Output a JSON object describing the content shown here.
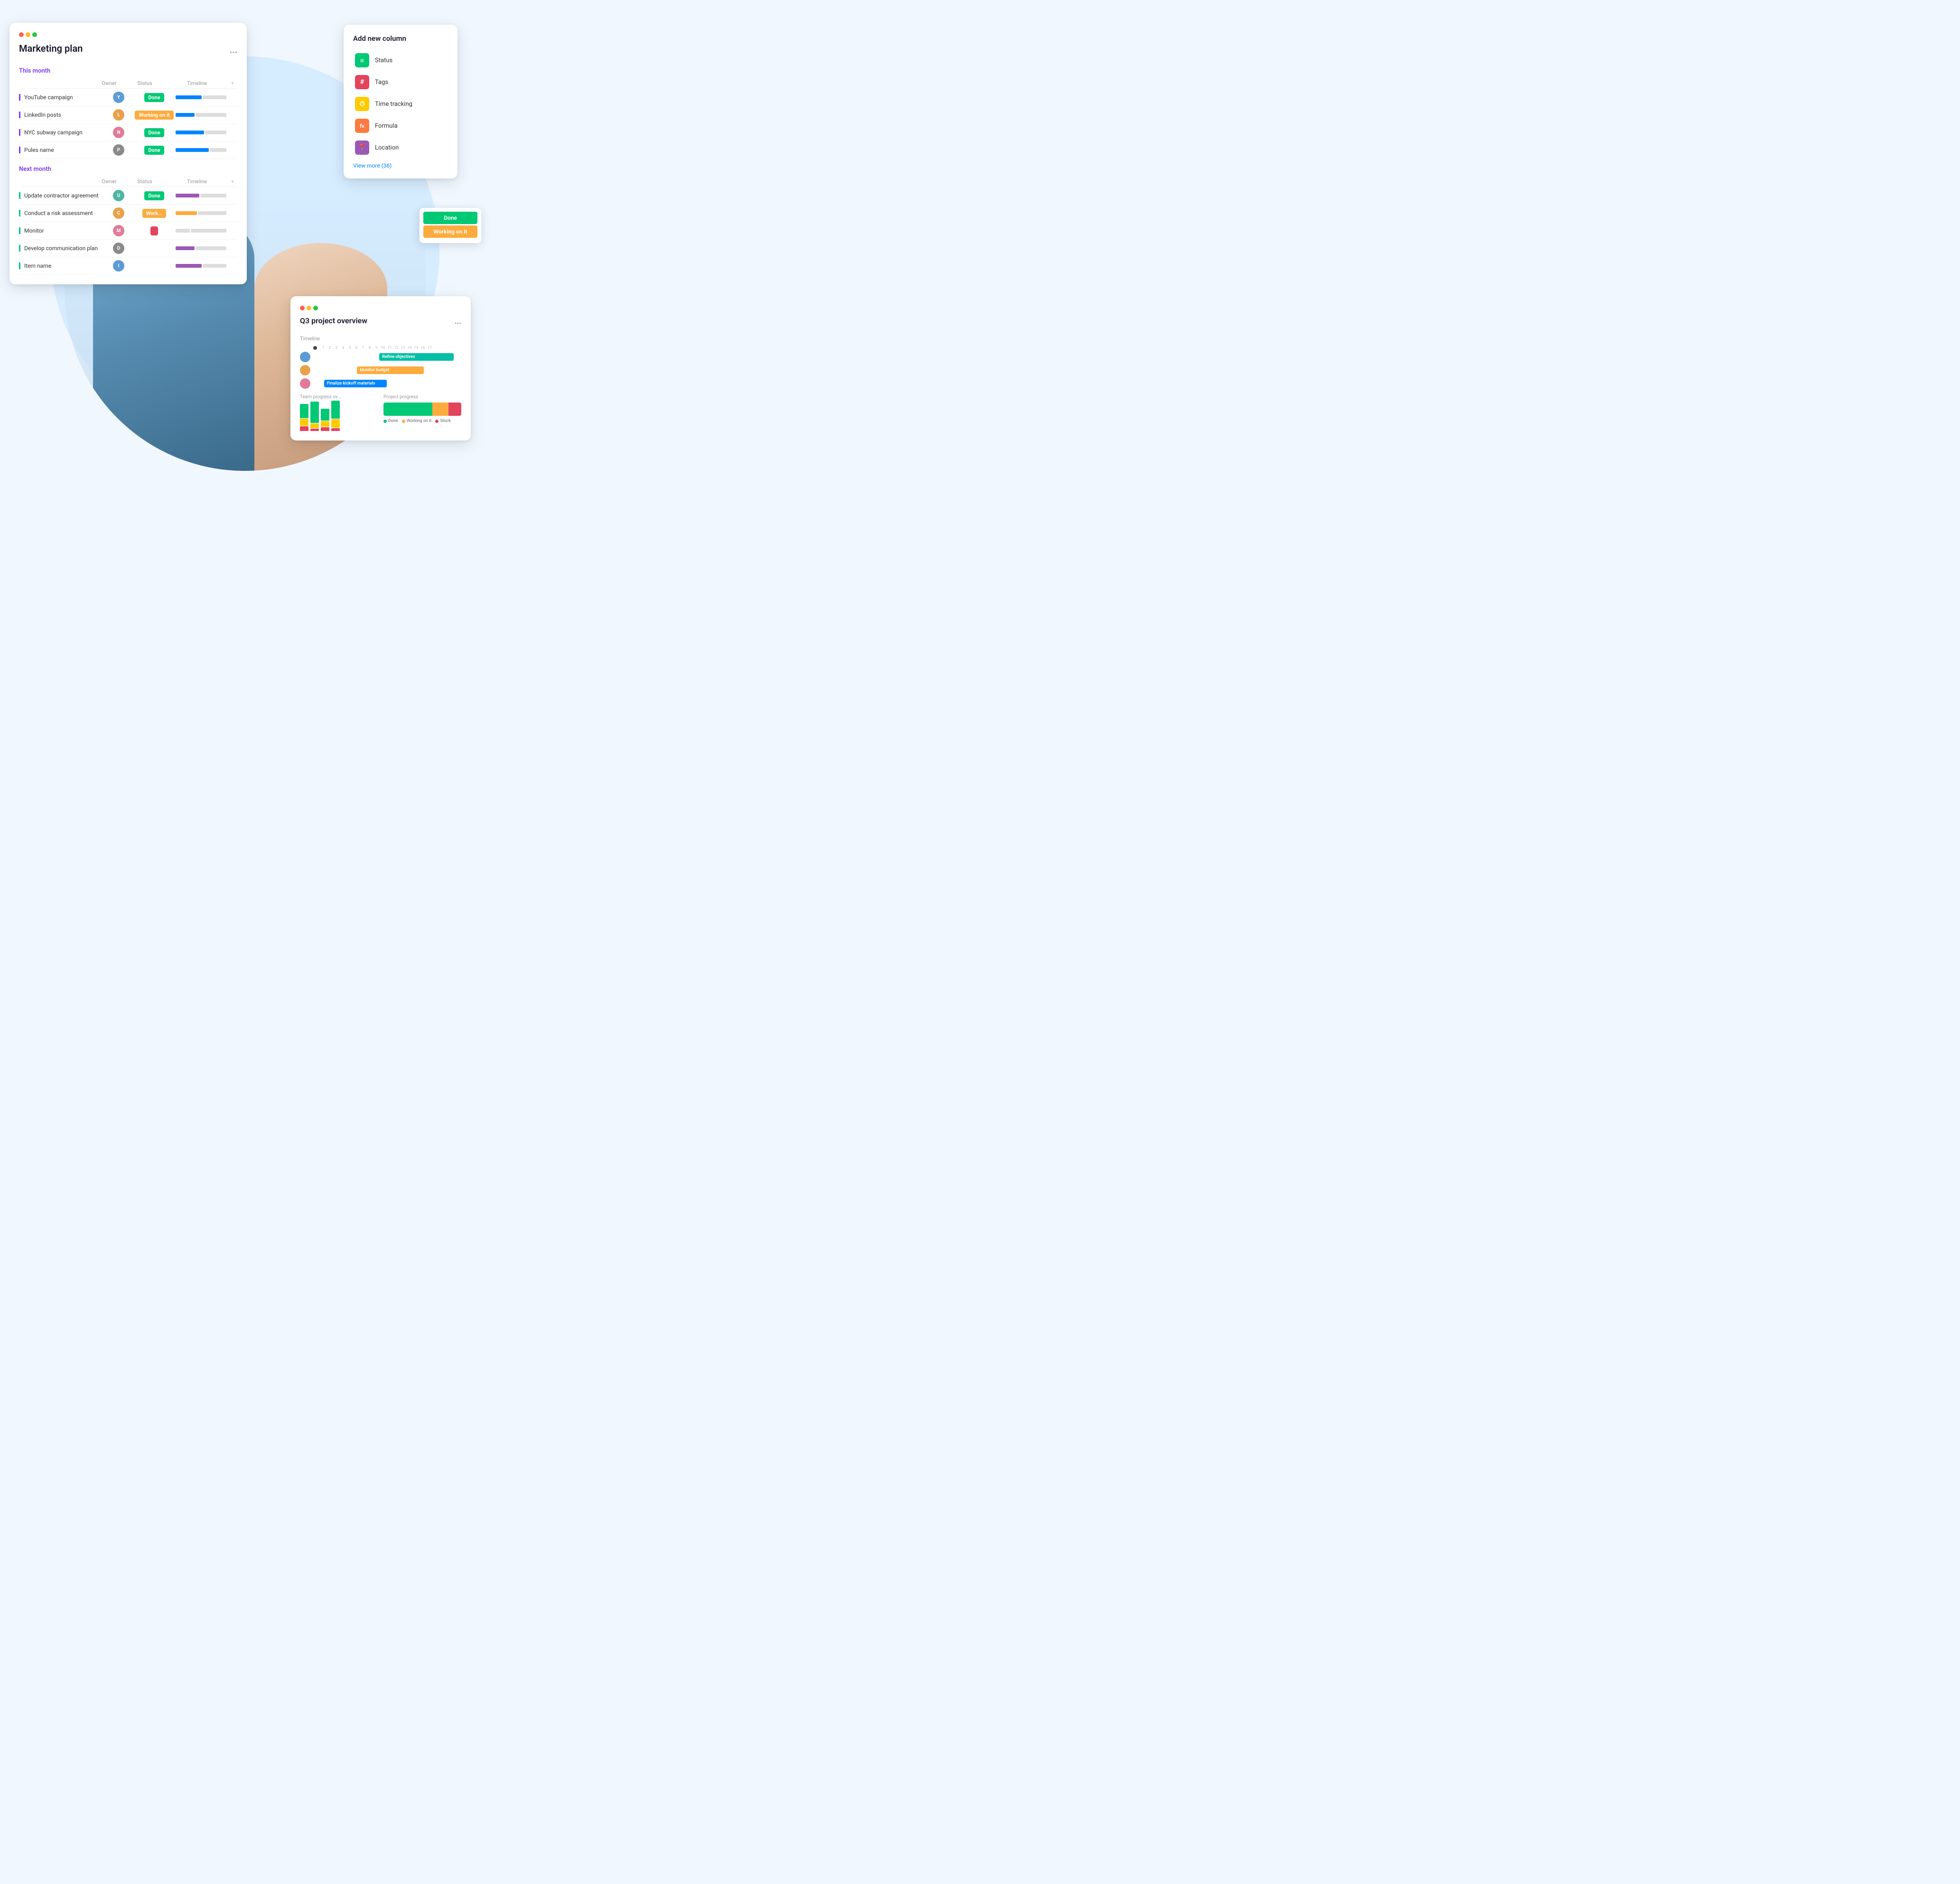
{
  "background": {
    "circle_color": "#d6ecff"
  },
  "marketing_card": {
    "title": "Marketing plan",
    "more_icon": "•••",
    "this_month_label": "This month",
    "next_month_label": "Next month",
    "columns": {
      "owner": "Owner",
      "status": "Status",
      "timeline": "Timeline"
    },
    "this_month_rows": [
      {
        "name": "YouTube campaign",
        "avatar_color": "blue",
        "avatar_text": "Y",
        "status": "Done",
        "status_class": "done",
        "border": "purple-border"
      },
      {
        "name": "LinkedIn posts",
        "avatar_color": "orange",
        "avatar_text": "L",
        "status": "Working on it",
        "status_class": "working",
        "border": "purple-border"
      },
      {
        "name": "NYC subway campaign",
        "avatar_color": "pink",
        "avatar_text": "N",
        "status": "Done",
        "status_class": "done",
        "border": "purple-border"
      },
      {
        "name": "Pules name",
        "avatar_color": "gray",
        "avatar_text": "P",
        "status": "Done",
        "status_class": "done",
        "border": "purple-border"
      }
    ],
    "next_month_rows": [
      {
        "name": "Update contractor agreement",
        "avatar_color": "teal",
        "avatar_text": "U",
        "status": "Done",
        "status_class": "done",
        "border": "green-border"
      },
      {
        "name": "Conduct a risk assessment",
        "avatar_color": "orange",
        "avatar_text": "C",
        "status": "Work...",
        "status_class": "working",
        "border": "green-border"
      },
      {
        "name": "Monitor",
        "avatar_color": "pink",
        "avatar_text": "M",
        "status": "",
        "status_class": "red",
        "border": "green-border"
      },
      {
        "name": "Develop communication plan",
        "avatar_color": "gray",
        "avatar_text": "D",
        "status": "",
        "status_class": "",
        "border": "green-border"
      },
      {
        "name": "Item name",
        "avatar_color": "blue",
        "avatar_text": "I",
        "status": "",
        "status_class": "",
        "border": "green-border"
      }
    ]
  },
  "add_column_card": {
    "title": "Add new column",
    "items": [
      {
        "icon": "≡",
        "icon_class": "icon-green",
        "label": "Status"
      },
      {
        "icon": "#",
        "icon_class": "icon-pink",
        "label": "Tags"
      },
      {
        "icon": "⏱",
        "icon_class": "icon-yellow",
        "label": "Time tracking"
      },
      {
        "icon": "fx",
        "icon_class": "icon-orange",
        "label": "Formula"
      },
      {
        "icon": "📍",
        "icon_class": "icon-purple",
        "label": "Location"
      }
    ],
    "view_more": "View more (36)"
  },
  "q3_card": {
    "title": "Q3 project overview",
    "more_icon": "•••",
    "timeline_label": "Timeline",
    "ruler_marks": [
      "1",
      "2",
      "3",
      "4",
      "5",
      "6",
      "7",
      "8",
      "9",
      "10",
      "11",
      "12",
      "13",
      "14",
      "15",
      "16",
      "17"
    ],
    "gantt_rows": [
      {
        "bar_label": "Refine objectives",
        "bar_class": "bar-teal",
        "left_pct": "45%",
        "width_pct": "45%"
      },
      {
        "bar_label": "Monitor budget",
        "bar_class": "bar-orange",
        "left_pct": "30%",
        "width_pct": "40%"
      },
      {
        "bar_label": "Finalize kickoff materials",
        "bar_class": "bar-blue",
        "left_pct": "10%",
        "width_pct": "38%"
      }
    ],
    "team_progress_label": "Team progress ov...",
    "project_progress_label": "Project progress",
    "bar_chart_data": [
      {
        "green": 30,
        "yellow": 15,
        "red": 10
      },
      {
        "green": 45,
        "yellow": 20,
        "red": 5
      },
      {
        "green": 25,
        "yellow": 10,
        "red": 15
      },
      {
        "green": 40,
        "yellow": 25,
        "red": 8
      }
    ],
    "legend_items": [
      {
        "label": "Done",
        "color": "#00c875"
      },
      {
        "label": "Working on it",
        "color": "#fdab3d"
      },
      {
        "label": "Stuck",
        "color": "#e2445c"
      }
    ]
  },
  "status_dropdown": {
    "items": [
      {
        "label": "Done",
        "class": "di-done"
      },
      {
        "label": "Working on it",
        "class": "di-working"
      }
    ]
  }
}
